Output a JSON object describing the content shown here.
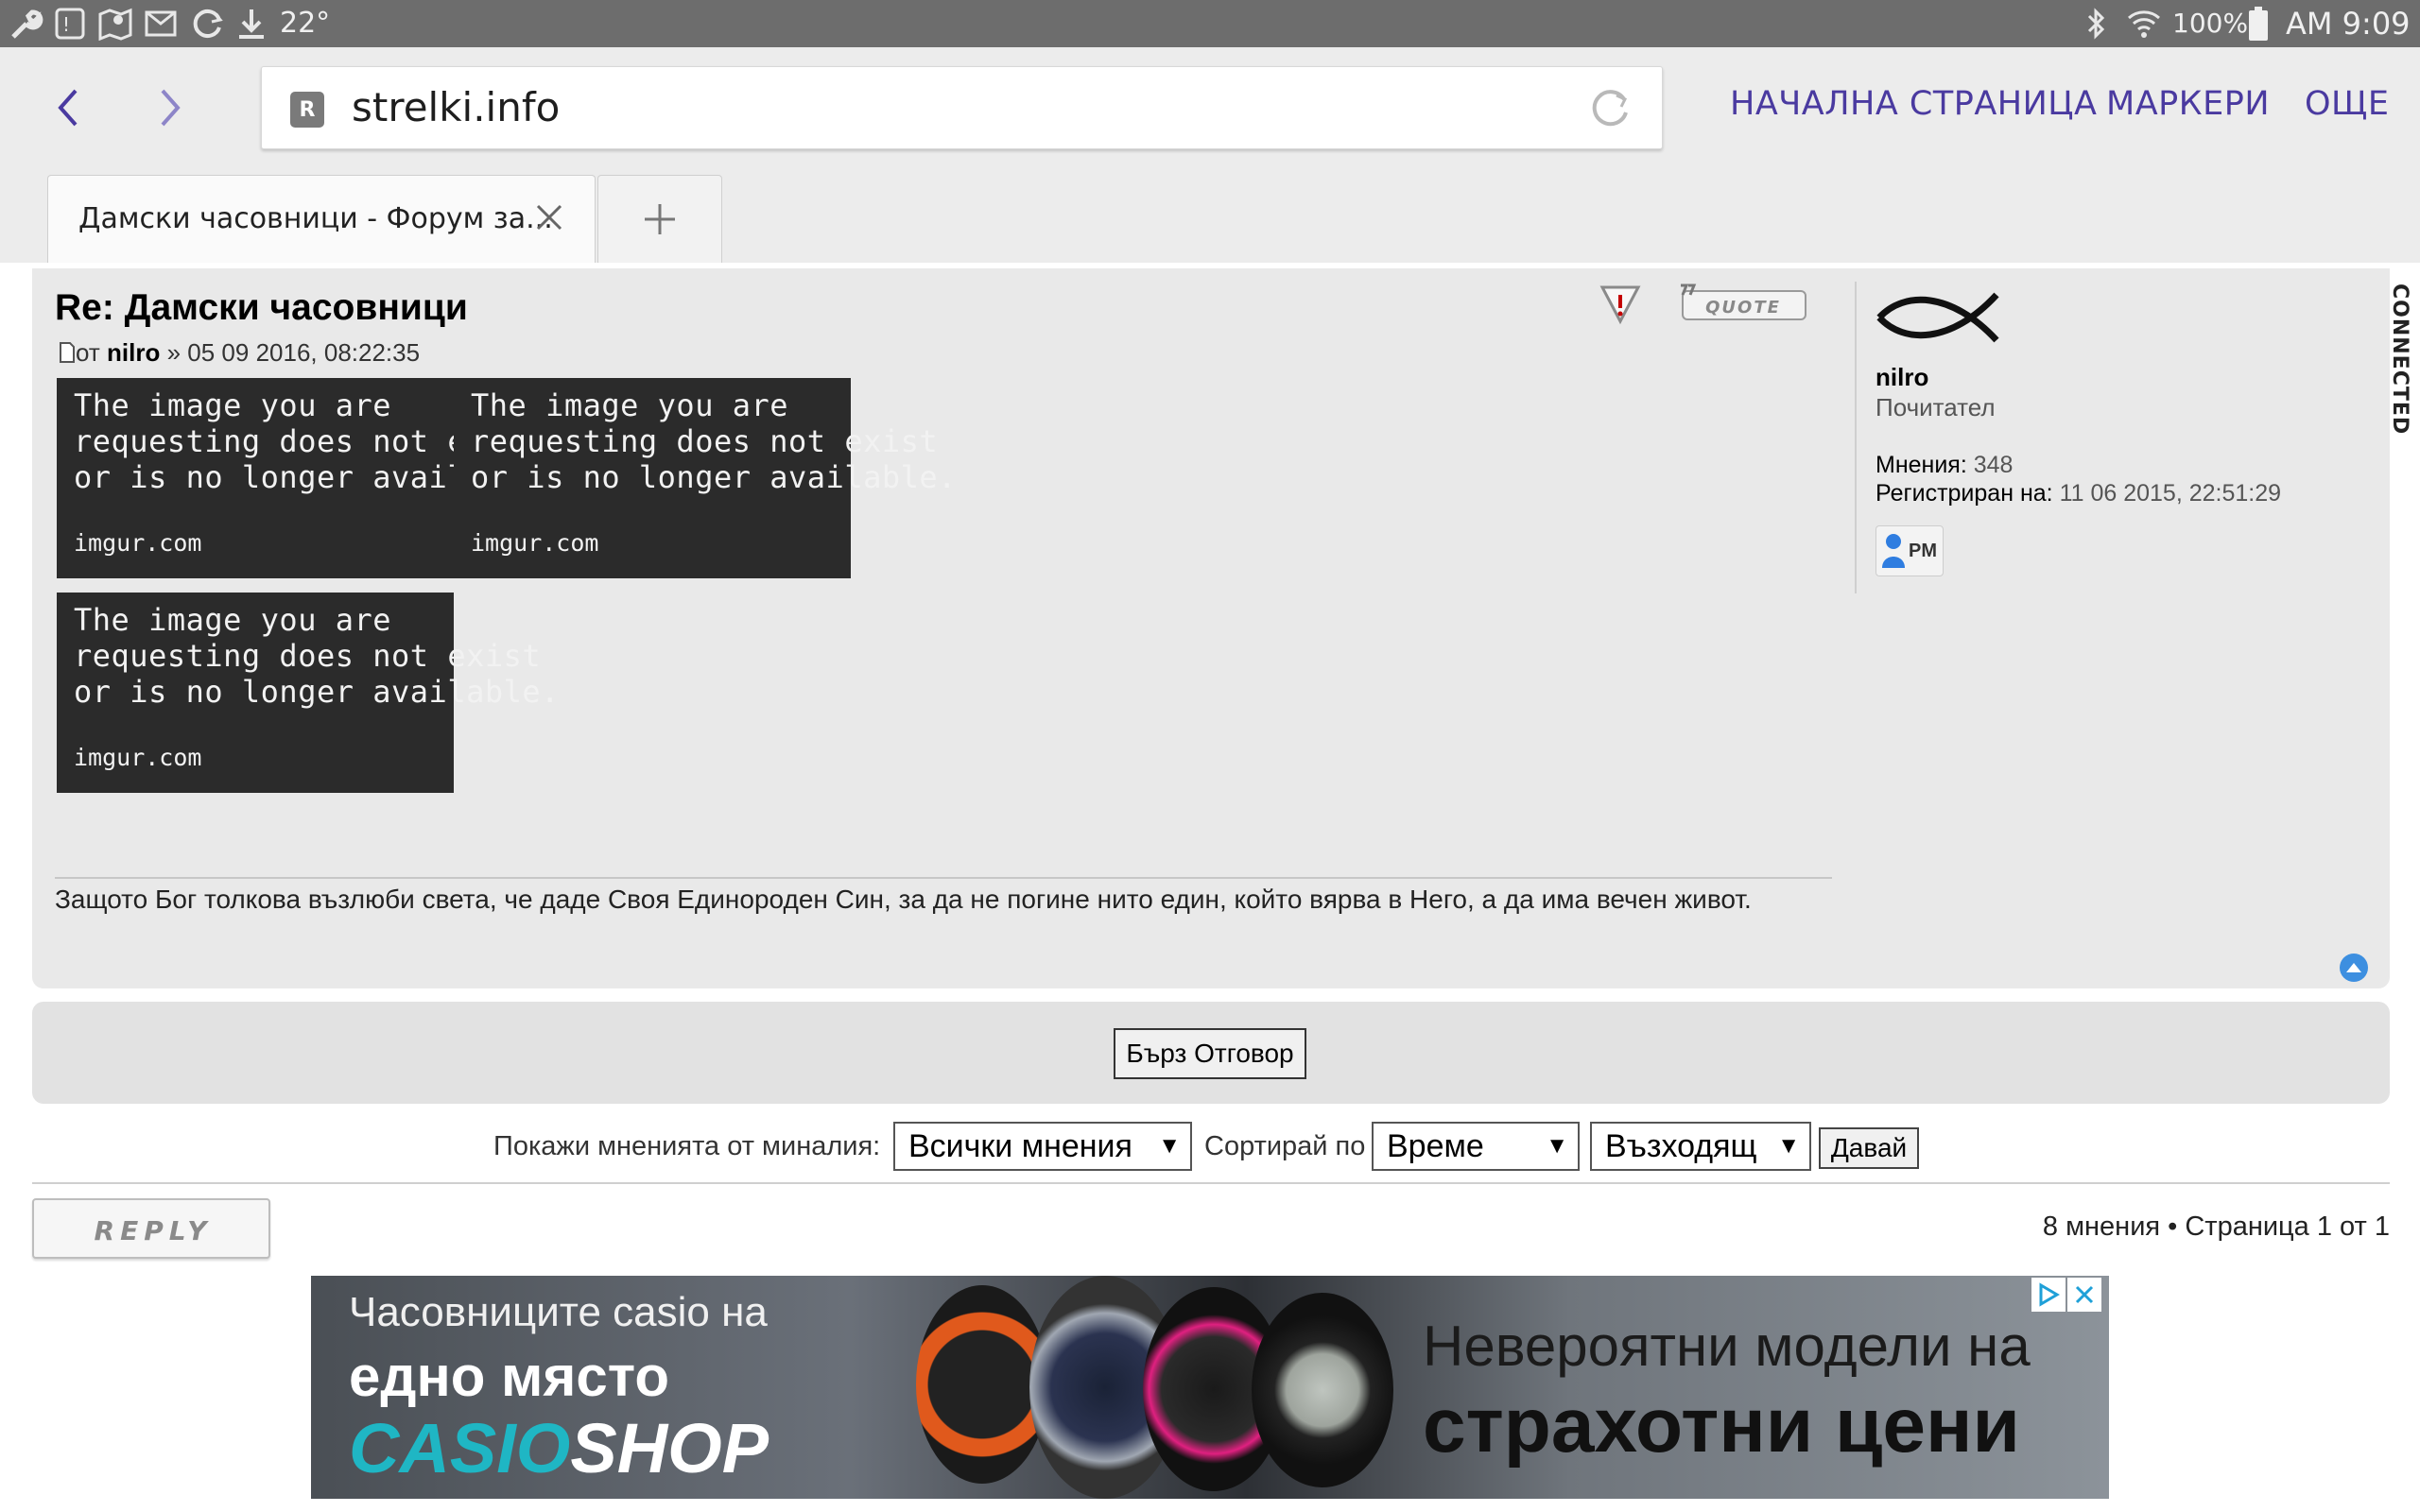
{
  "status_bar": {
    "temperature": "22°",
    "battery": "100%",
    "time": "AM 9:09"
  },
  "browser": {
    "url": "strelki.info",
    "site_badge": "R",
    "links": {
      "home": "НАЧАЛНА СТРАНИЦА",
      "bookmarks": "МАРКЕРИ",
      "more": "ОЩЕ"
    },
    "tab_title": "Дамски часовници - Форум за...",
    "accent_color": "#4a3aa0"
  },
  "post": {
    "title": "Re: Дамски часовници",
    "meta_prefix": "от",
    "author": "nilro",
    "meta_date": "» 05 09 2016, 08:22:35",
    "images": [
      {
        "message": "The image you are\nrequesting does not exist\nor is no longer available.",
        "source": "imgur.com"
      },
      {
        "message": "The image you are\nrequesting does not exist\nor is no longer available.",
        "source": "imgur.com"
      },
      {
        "message": "The image you are\nrequesting does not exist\nor is no longer available.",
        "source": "imgur.com"
      }
    ],
    "signature": "Защото Бог толкова възлюби света, че даде Своя Единороден Син, за да не погине нито един, който вярва в Него, а да има вечен живот.",
    "quote_label": "QUOTE",
    "status_label": "CONNECTED"
  },
  "profile": {
    "name": "nilro",
    "rank": "Почитател",
    "posts_label": "Мнения:",
    "posts_value": "348",
    "registered_label": "Регистриран на:",
    "registered_value": "11 06 2015, 22:51:29",
    "pm_label": "PM"
  },
  "quick_reply": {
    "label": "Бърз Отговор"
  },
  "sort": {
    "show_label": "Покажи мненията от миналия:",
    "show_value": "Всички мнения",
    "sort_label": "Сортирай по",
    "sort_value": "Време",
    "order_value": "Възходящ",
    "go_label": "Давай"
  },
  "footer": {
    "reply_label": "REPLY",
    "pagination": "8 мнения • Страница 1 от 1"
  },
  "ad": {
    "left_line1": "Часовниците casio на",
    "left_line2": "едно място",
    "brand_a": "CASIO",
    "brand_b": "SHOP",
    "right_line1": "Невероятни модели на",
    "right_line2": "страхотни цени"
  }
}
